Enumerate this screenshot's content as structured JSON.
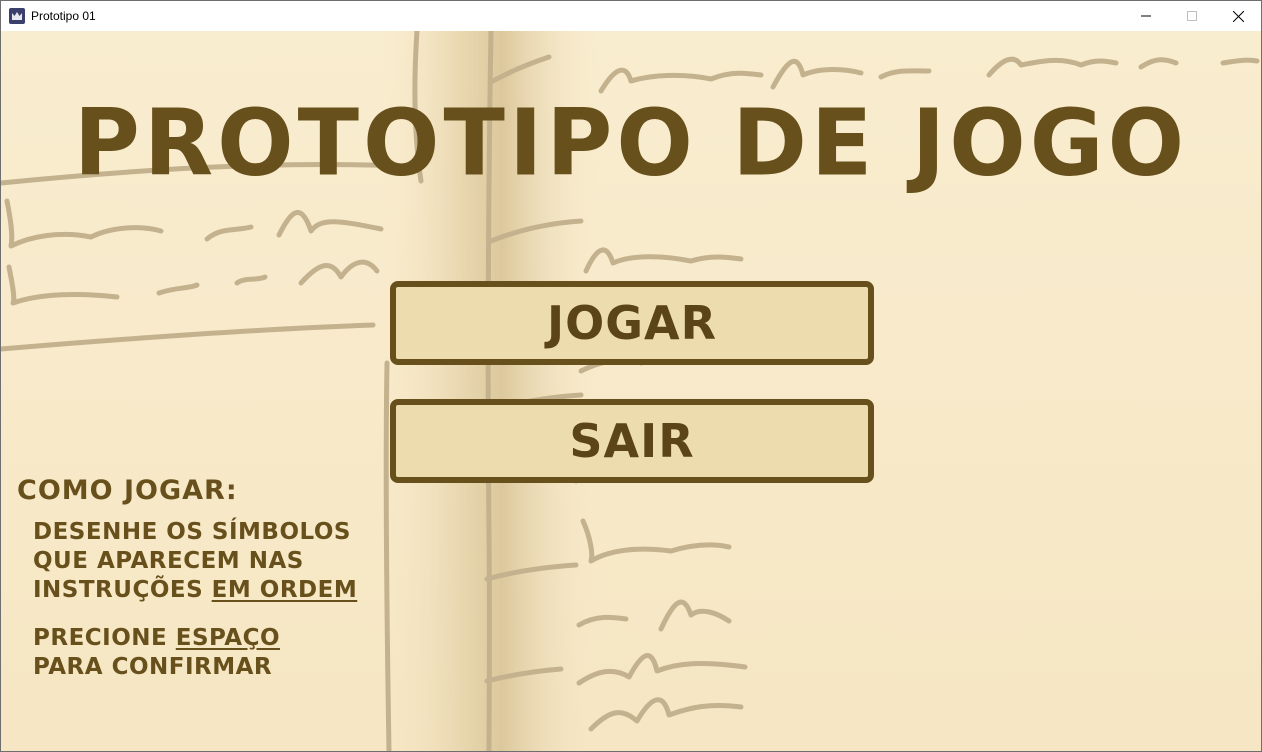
{
  "window": {
    "title": "Prototipo 01",
    "icon": "game-maker-icon",
    "controls": [
      "minimize-icon",
      "maximize-icon",
      "close-icon"
    ]
  },
  "game": {
    "title": "PROTOTIPO DE JOGO",
    "menu": {
      "play_label": "JOGAR",
      "exit_label": "SAIR"
    },
    "how_to_play": {
      "title": "COMO JOGAR:",
      "line1": "DESENHE OS SÍMBOLOS",
      "line2": "QUE APARECEM NAS",
      "line3_prefix": "INSTRUÇÕES ",
      "line3_emphasis": "EM ORDEM",
      "line4_prefix": "PRECIONE ",
      "line4_emphasis": "ESPAÇO",
      "line5": "PARA CONFIRMAR"
    }
  },
  "colors": {
    "ink": "#67501b",
    "button_fill": "#eddcae",
    "paper": "#f8eacb",
    "sketch": "#c2b18c"
  }
}
